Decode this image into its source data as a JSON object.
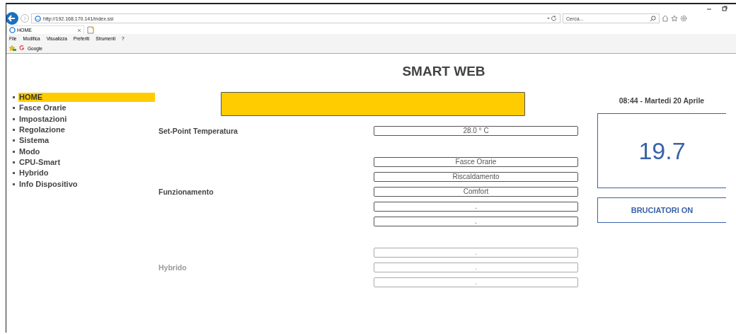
{
  "browser": {
    "address": "http://192.168.170.141/index.ssi",
    "search_placeholder": "Cerca...",
    "tabs": [
      {
        "label": "HOME",
        "selected": true
      }
    ],
    "menu": [
      "File",
      "Modifica",
      "Visualizza",
      "Preferiti",
      "Strumenti",
      "?"
    ],
    "favorites": [
      "Google"
    ]
  },
  "page": {
    "title": "SMART WEB",
    "nav": [
      {
        "label": "HOME",
        "selected": true
      },
      {
        "label": "Fasce Orarie",
        "selected": false
      },
      {
        "label": "Impostazioni",
        "selected": false
      },
      {
        "label": "Regolazione",
        "selected": false
      },
      {
        "label": "Sistema",
        "selected": false
      },
      {
        "label": "Modo",
        "selected": false
      },
      {
        "label": "CPU-Smart",
        "selected": false
      },
      {
        "label": "Hybrido",
        "selected": false
      },
      {
        "label": "Info Dispositivo",
        "selected": false
      }
    ],
    "groups": [
      {
        "disabled": false,
        "rows": [
          {
            "label": "Set-Point Temperatura",
            "value": "28.0 ° C"
          }
        ]
      },
      {
        "disabled": false,
        "rows": [
          {
            "value": "Fasce Orarie"
          },
          {
            "value": "Riscaldamento"
          },
          {
            "label": "Funzionamento",
            "value": "Comfort"
          },
          {
            "value": "."
          },
          {
            "value": "."
          }
        ]
      },
      {
        "disabled": true,
        "rows": [
          {
            "value": "."
          },
          {
            "label": "Hybrido",
            "value": "."
          },
          {
            "value": "."
          }
        ]
      }
    ],
    "clock": "08:44 - Martedi 20 Aprile",
    "temperature": "19.7",
    "burner_status": "BRUCIATORI ON"
  }
}
